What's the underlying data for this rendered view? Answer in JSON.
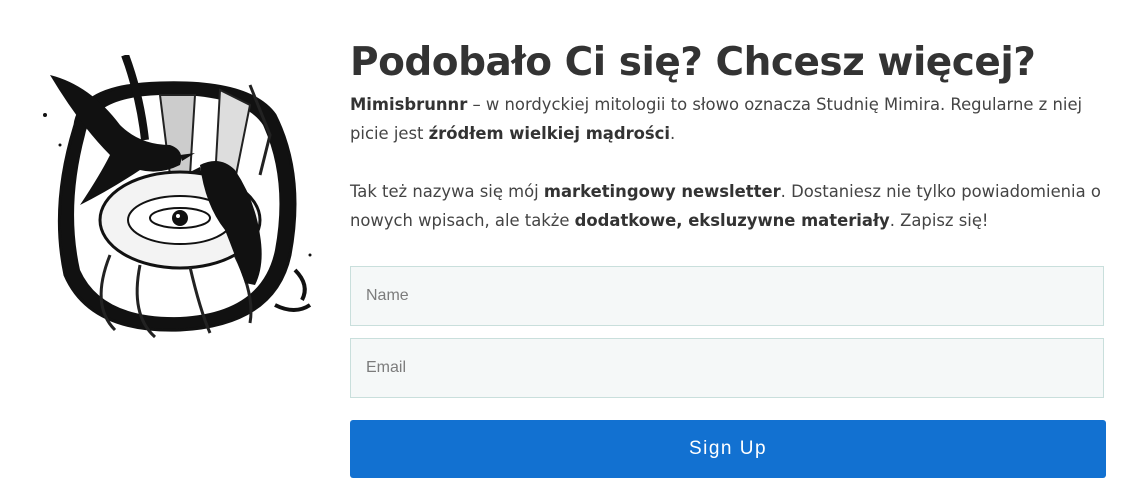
{
  "illustration": {
    "name": "raven-eye-well-illustration"
  },
  "heading": "Podobało Ci się? Chcesz więcej?",
  "intro": {
    "bold1": "Mimisbrunnr",
    "text1": " – w nordyckiej mitologii to słowo oznacza Studnię Mimira. Regularne z niej picie jest ",
    "bold2": "źródłem wielkiej mądrości",
    "text2": "."
  },
  "pitch": {
    "text1": "Tak też nazywa się mój ",
    "bold1": "marketingowy newsletter",
    "text2": ". Dostaniesz nie tylko powiadomienia o nowych wpisach, ale także ",
    "bold2": "dodatkowe, eksluzywne materiały",
    "text3": ". Zapisz się!"
  },
  "form": {
    "name_placeholder": "Name",
    "email_placeholder": "Email",
    "submit_label": "Sign Up"
  }
}
